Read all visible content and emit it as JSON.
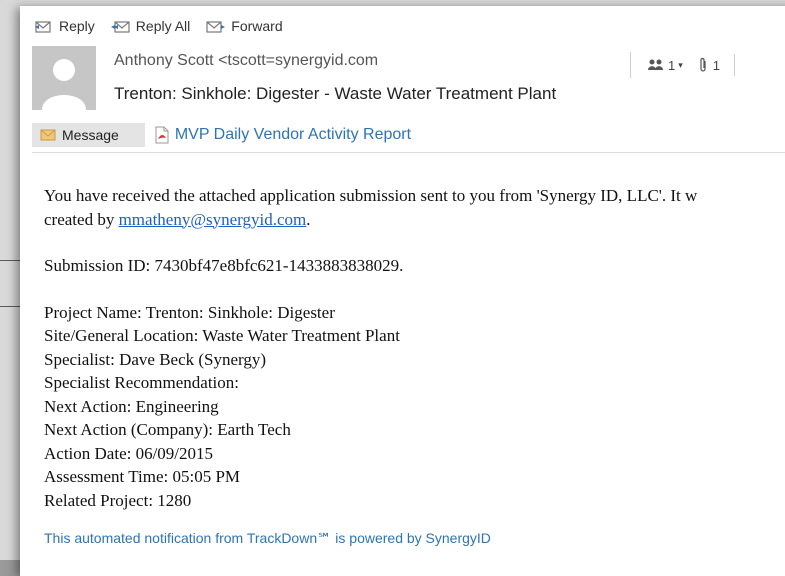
{
  "toolbar": {
    "reply_label": "Reply",
    "reply_all_label": "Reply All",
    "forward_label": "Forward"
  },
  "header": {
    "sender": "Anthony Scott <tscott=synergyid.com",
    "subject": "Trenton: Sinkhole: Digester - Waste Water Treatment Plant",
    "people_count": "1",
    "attachment_count": "1"
  },
  "tabs": {
    "message_label": "Message",
    "attachment_label": "MVP Daily Vendor Activity Report"
  },
  "body": {
    "intro_part1": "You have received the attached application submission sent to you from 'Synergy ID, LLC'. It w",
    "intro_part2_prefix": "created by ",
    "intro_link": "mmatheny@synergyid.com",
    "intro_part2_suffix": ".",
    "submission_id": "Submission ID: 7430bf47e8bfc621-1433883838029.",
    "fields": [
      "Project Name: Trenton: Sinkhole: Digester",
      "Site/General Location: Waste Water Treatment Plant",
      "Specialist: Dave Beck (Synergy)",
      "Specialist Recommendation:",
      "Next Action: Engineering",
      "Next Action (Company): Earth Tech",
      "Action Date: 06/09/2015",
      "Assessment Time: 05:05 PM",
      "Related Project: 1280"
    ],
    "footer": "This automated notification from TrackDown℠ is powered by SynergyID"
  }
}
